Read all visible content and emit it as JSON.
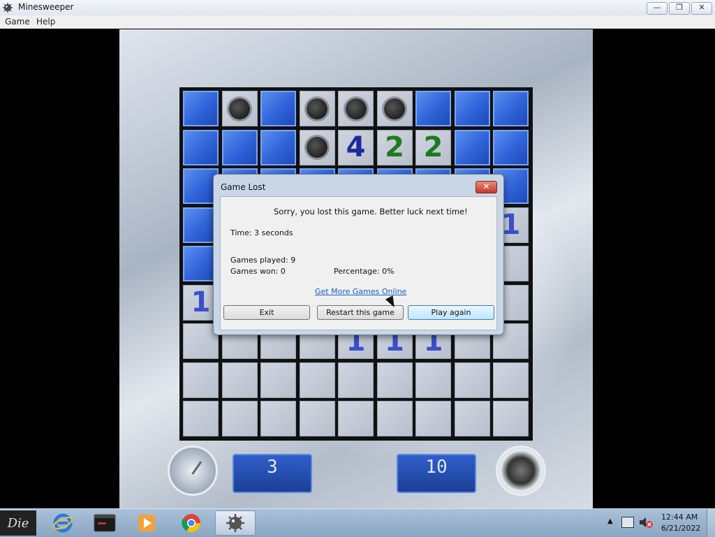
{
  "window": {
    "title": "Minesweeper",
    "controls": {
      "minimize": "—",
      "maximize": "❐",
      "close": "✕"
    }
  },
  "menu": {
    "game": "Game",
    "help": "Help"
  },
  "board": {
    "rows": [
      [
        "C",
        "M",
        "C",
        "M",
        "M",
        "M",
        "C",
        "C",
        "C"
      ],
      [
        "C",
        "C",
        "C",
        "M",
        "4",
        "2",
        "2",
        "C",
        "C"
      ],
      [
        "C",
        "C",
        "C",
        "C",
        "C",
        "C",
        "C",
        "C",
        "C"
      ],
      [
        "C",
        "C",
        "C",
        "C",
        "C",
        "C",
        "C",
        "C",
        "1"
      ],
      [
        "C",
        "C",
        "C",
        "C",
        "C",
        "C",
        "C",
        "C",
        "0"
      ],
      [
        "1",
        "C",
        "C",
        "C",
        "C",
        "C",
        "C",
        "C",
        "0"
      ],
      [
        "0",
        "0",
        "0",
        "0",
        "1",
        "1",
        "1",
        "0",
        "0"
      ],
      [
        "0",
        "0",
        "0",
        "0",
        "0",
        "0",
        "0",
        "0",
        "0"
      ],
      [
        "0",
        "0",
        "0",
        "0",
        "0",
        "0",
        "0",
        "0",
        "0"
      ]
    ],
    "legend": {
      "C": "covered",
      "M": "mine",
      "0": "empty"
    }
  },
  "counters": {
    "time": "3",
    "mines": "10"
  },
  "icons": {
    "clock": "clock-icon",
    "mines": "mine-icon"
  },
  "dialog": {
    "title": "Game Lost",
    "close": "✕",
    "message": "Sorry, you lost this game. Better luck next time!",
    "time": "Time: 3 seconds",
    "games_played": "Games played: 9",
    "games_won": "Games won: 0",
    "percentage": "Percentage: 0%",
    "link": "Get More Games Online",
    "buttons": {
      "exit": "Exit",
      "restart": "Restart this game",
      "play_again": "Play again"
    }
  },
  "taskbar": {
    "start": "Die",
    "apps": [
      "internet-explorer-icon",
      "terminal-icon",
      "media-player-icon",
      "chrome-icon",
      "minesweeper-icon"
    ],
    "clock_time": "12:44 AM",
    "clock_date": "6/21/2022"
  }
}
